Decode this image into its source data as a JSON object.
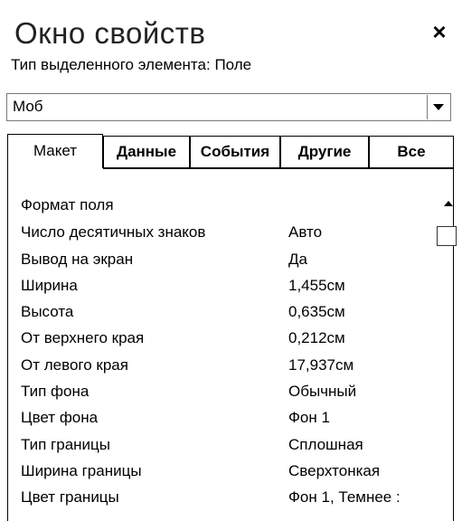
{
  "pane": {
    "title": "Окно свойств",
    "close_icon": "×"
  },
  "selection": {
    "label": "Тип выделенного элемента:",
    "type": "Поле"
  },
  "object_combo": {
    "value": "Моб"
  },
  "tabs": [
    {
      "label": "Макет",
      "active": true
    },
    {
      "label": "Данные",
      "active": false
    },
    {
      "label": "События",
      "active": false
    },
    {
      "label": "Другие",
      "active": false
    },
    {
      "label": "Все",
      "active": false
    }
  ],
  "properties": [
    {
      "name": "Формат поля",
      "value": ""
    },
    {
      "name": "Число десятичных знаков",
      "value": "Авто"
    },
    {
      "name": "Вывод на экран",
      "value": "Да"
    },
    {
      "name": "Ширина",
      "value": "1,455см"
    },
    {
      "name": "Высота",
      "value": "0,635см"
    },
    {
      "name": "От верхнего края",
      "value": "0,212см"
    },
    {
      "name": "От левого края",
      "value": "17,937см"
    },
    {
      "name": "Тип фона",
      "value": "Обычный"
    },
    {
      "name": "Цвет фона",
      "value": "Фон 1"
    },
    {
      "name": "Тип границы",
      "value": "Сплошная"
    },
    {
      "name": "Ширина границы",
      "value": "Сверхтонкая"
    },
    {
      "name": "Цвет границы",
      "value": "Фон 1, Темнее :"
    }
  ]
}
